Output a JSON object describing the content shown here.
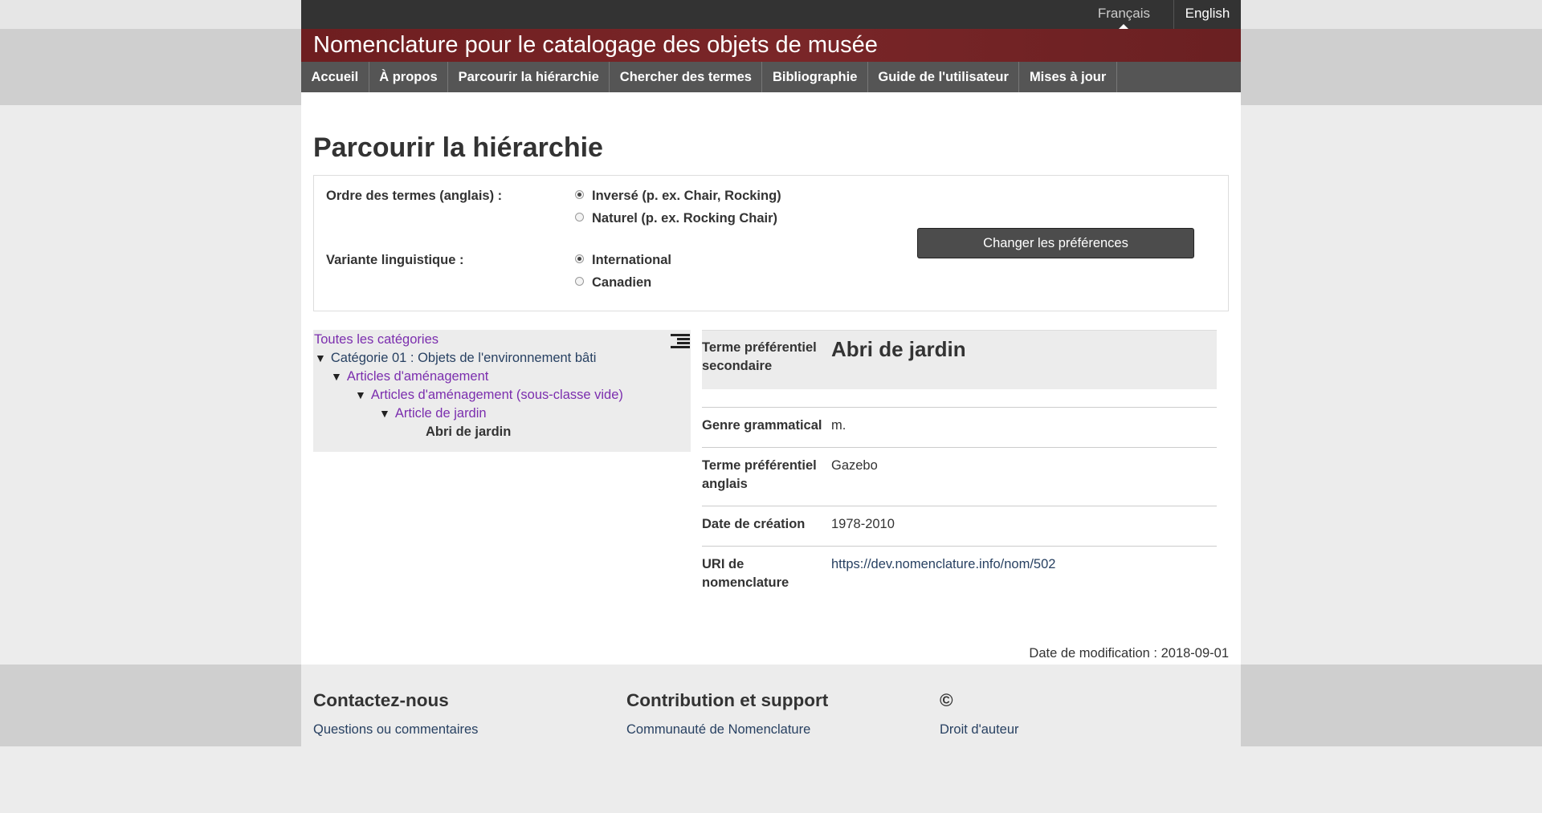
{
  "lang": {
    "fr": "Français",
    "en": "English"
  },
  "site_title": "Nomenclature pour le catalogage des objets de musée",
  "nav": [
    "Accueil",
    "À propos",
    "Parcourir la hiérarchie",
    "Chercher des termes",
    "Bibliographie",
    "Guide de l'utilisateur",
    "Mises à jour"
  ],
  "page_title": "Parcourir la hiérarchie",
  "prefs": {
    "order_label": "Ordre des termes (anglais) :",
    "order_options": [
      "Inversé (p. ex. Chair, Rocking)",
      "Naturel (p. ex. Rocking Chair)"
    ],
    "order_selected": 0,
    "variant_label": "Variante linguistique :",
    "variant_options": [
      "International",
      "Canadien"
    ],
    "variant_selected": 0,
    "button": "Changer les préférences"
  },
  "tree": {
    "root": "Toutes les catégories",
    "nodes": [
      "Catégorie 01 : Objets de l'environnement bâti",
      "Articles d'aménagement",
      "Articles d'aménagement (sous-classe vide)",
      "Article de jardin"
    ],
    "current": "Abri de jardin",
    "icon": "collapse-list-icon"
  },
  "details": {
    "head_label": "Terme préférentiel secondaire",
    "head_value": "Abri de jardin",
    "rows": [
      {
        "label": "Genre grammatical",
        "value": "m."
      },
      {
        "label": "Terme préférentiel anglais",
        "value": "Gazebo"
      },
      {
        "label": "Date de création",
        "value": "1978-2010"
      },
      {
        "label": "URI de nomenclature",
        "value": "https://dev.nomenclature.info/nom/502"
      }
    ]
  },
  "modified": "Date de modification : 2018-09-01",
  "footer": {
    "cols": [
      {
        "title": "Contactez-nous",
        "link": "Questions ou commentaires"
      },
      {
        "title": "Contribution et support",
        "link": "Communauté de Nomenclature"
      },
      {
        "title": "©",
        "link": "Droit d'auteur"
      }
    ]
  }
}
